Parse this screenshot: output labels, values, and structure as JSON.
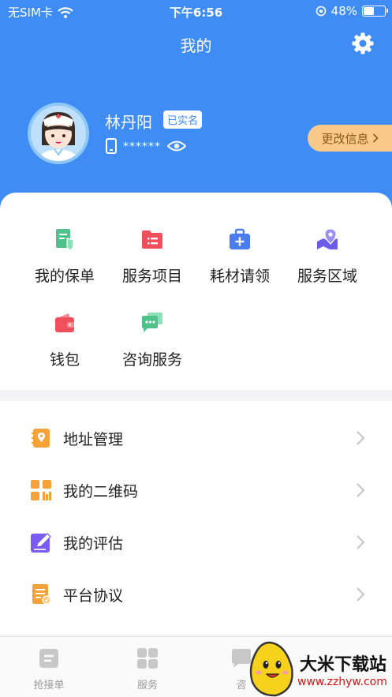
{
  "status_bar": {
    "carrier": "无SIM卡",
    "time": "下午6:56",
    "battery": "48%",
    "battery_level": 0.48
  },
  "nav": {
    "title": "我的"
  },
  "profile": {
    "name": "林丹阳",
    "verified_badge": "已实名",
    "phone_masked": "******",
    "edit_button": "更改信息"
  },
  "grid": [
    {
      "label": "我的保单",
      "icon": "policy-icon",
      "color": "#4fc28b"
    },
    {
      "label": "服务项目",
      "icon": "service-list-icon",
      "color": "#f0505c"
    },
    {
      "label": "耗材请领",
      "icon": "medical-kit-icon",
      "color": "#4a7cf0"
    },
    {
      "label": "服务区域",
      "icon": "map-pin-icon",
      "color": "#6a5ee8"
    },
    {
      "label": "钱包",
      "icon": "wallet-icon",
      "color": "#f0505c"
    },
    {
      "label": "咨询服务",
      "icon": "chat-icon",
      "color": "#4fc28b"
    }
  ],
  "menu": [
    {
      "label": "地址管理",
      "icon": "address-book-icon",
      "color": "#f5a23b"
    },
    {
      "label": "我的二维码",
      "icon": "qr-code-icon",
      "color": "#f5a23b"
    },
    {
      "label": "我的评估",
      "icon": "edit-icon",
      "color": "#7a5cf0"
    },
    {
      "label": "平台协议",
      "icon": "document-icon",
      "color": "#f5a23b"
    }
  ],
  "tabbar": [
    {
      "label": "抢接单",
      "icon": "order-icon"
    },
    {
      "label": "服务",
      "icon": "grid-icon"
    },
    {
      "label": "咨",
      "icon": "message-icon"
    }
  ],
  "watermark": {
    "title": "大米下载站",
    "url": "www.zzhyw.com"
  },
  "colors": {
    "header": "#3e8cf4",
    "accent": "#f9c98a"
  }
}
